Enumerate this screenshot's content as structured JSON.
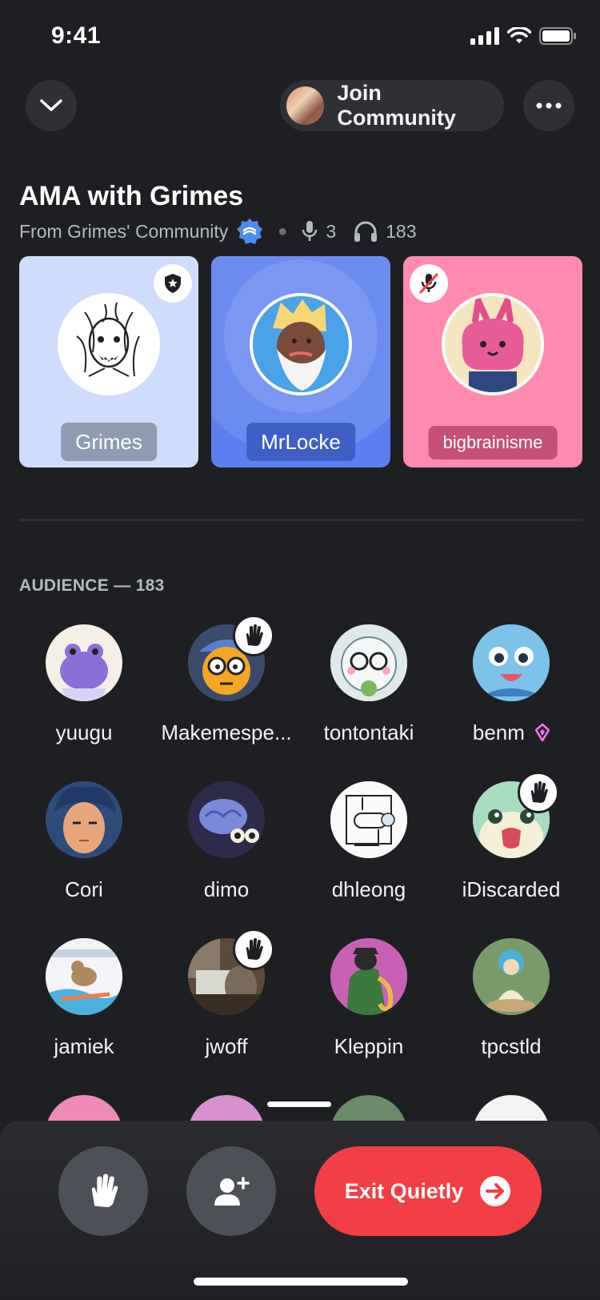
{
  "status_bar": {
    "time": "9:41"
  },
  "header": {
    "join_label": "Join Community"
  },
  "stage": {
    "title": "AMA with Grimes",
    "subtitle": "From Grimes' Community",
    "speaker_count": "3",
    "listener_count": "183"
  },
  "speakers": [
    {
      "name": "Grimes",
      "badge": "moderator-shield-icon",
      "card_color": "#cfdcfb"
    },
    {
      "name": "MrLocke",
      "badge": "",
      "card_color": "#5b7ff0"
    },
    {
      "name": "bigbrainisme",
      "badge": "muted-mic-icon",
      "card_color": "#ff8ab0"
    }
  ],
  "audience": {
    "header": "AUDIENCE — 183",
    "members": [
      {
        "name": "yuugu",
        "hand_raised": false
      },
      {
        "name": "Makemespe...",
        "hand_raised": true
      },
      {
        "name": "tontontaki",
        "hand_raised": false
      },
      {
        "name": "benm",
        "hand_raised": false,
        "nitro": true
      },
      {
        "name": "Cori",
        "hand_raised": false
      },
      {
        "name": "dimo",
        "hand_raised": false
      },
      {
        "name": "dhleong",
        "hand_raised": false
      },
      {
        "name": "iDiscarded",
        "hand_raised": true
      },
      {
        "name": "jamiek",
        "hand_raised": false
      },
      {
        "name": "jwoff",
        "hand_raised": true
      },
      {
        "name": "Kleppin",
        "hand_raised": false
      },
      {
        "name": "tpcstld",
        "hand_raised": false
      }
    ]
  },
  "bottom_bar": {
    "exit_label": "Exit Quietly"
  }
}
